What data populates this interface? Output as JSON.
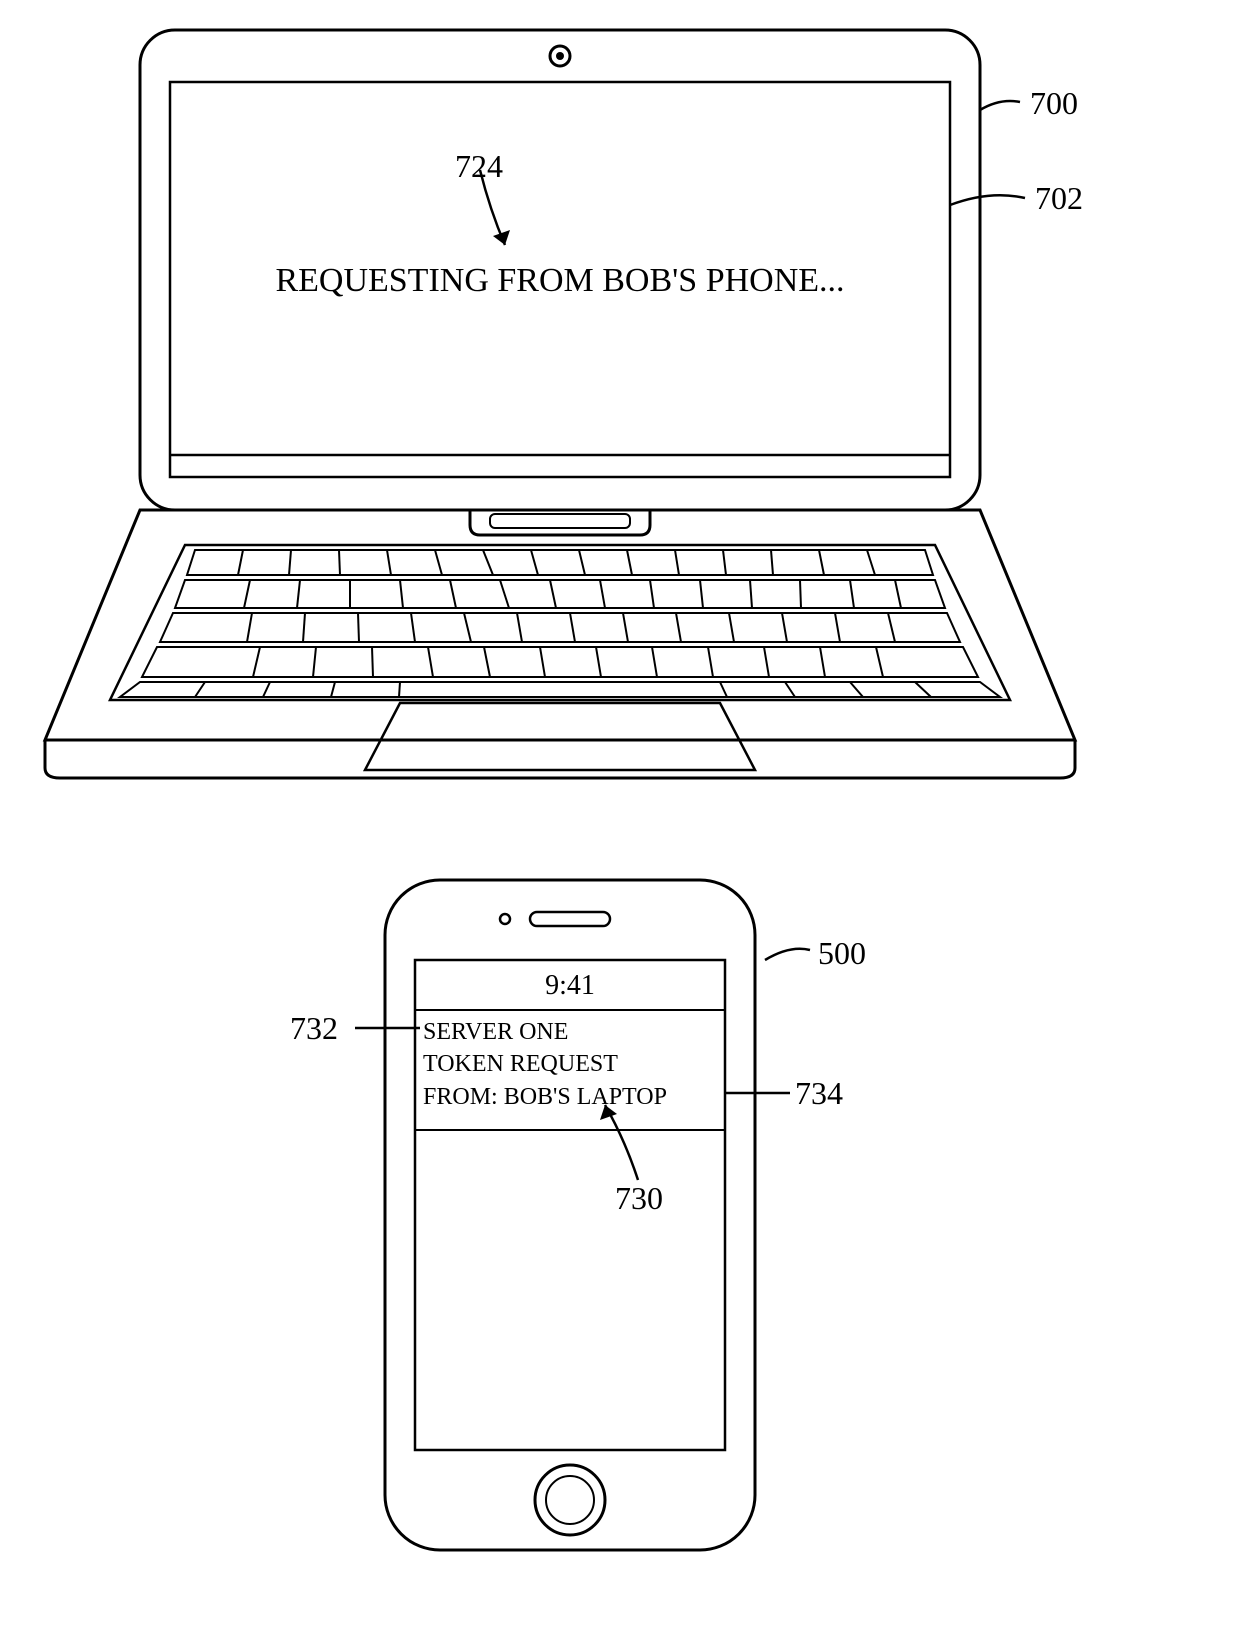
{
  "laptop": {
    "screen_text": "REQUESTING FROM BOB'S PHONE..."
  },
  "phone": {
    "time": "9:41",
    "line1": "SERVER ONE",
    "line2": "TOKEN REQUEST",
    "line3": "FROM: BOB'S LAPTOP"
  },
  "refs": {
    "r700": "700",
    "r702": "702",
    "r724": "724",
    "r500": "500",
    "r732": "732",
    "r734": "734",
    "r730": "730"
  }
}
